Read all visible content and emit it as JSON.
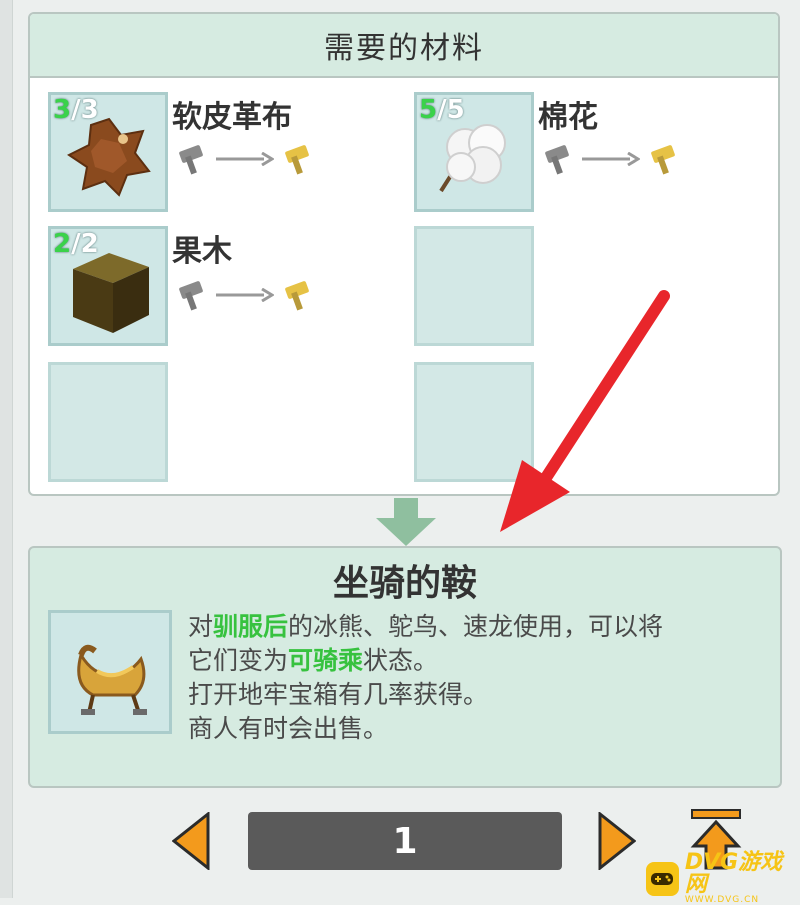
{
  "materials": {
    "header": "需要的材料",
    "items": [
      {
        "name": "软皮革布",
        "have": "3",
        "need": "/3",
        "icon": "leather-icon"
      },
      {
        "name": "棉花",
        "have": "5",
        "need": "/5",
        "icon": "cotton-icon"
      },
      {
        "name": "果木",
        "have": "2",
        "need": "/2",
        "icon": "fruitwood-block-icon"
      }
    ]
  },
  "result": {
    "title": "坐骑的鞍",
    "icon": "saddle-icon",
    "desc": {
      "p1": "对",
      "h1": "驯服后",
      "p2": "的冰熊、鸵鸟、速龙使用，可以将",
      "p3": "它们变为",
      "h2": "可骑乘",
      "p4": "状态。",
      "line3": "打开地牢宝箱有几率获得。",
      "line4": "商人有时会出售。"
    }
  },
  "pager": {
    "page": "1"
  },
  "watermark": {
    "main": "DVG游戏网",
    "sub": "WWW.DVG.CN"
  },
  "colors": {
    "count_have": "#3ad24a",
    "highlight": "#37c23f",
    "arrow_orange": "#f39a1c",
    "annotation_red": "#e8262b"
  }
}
